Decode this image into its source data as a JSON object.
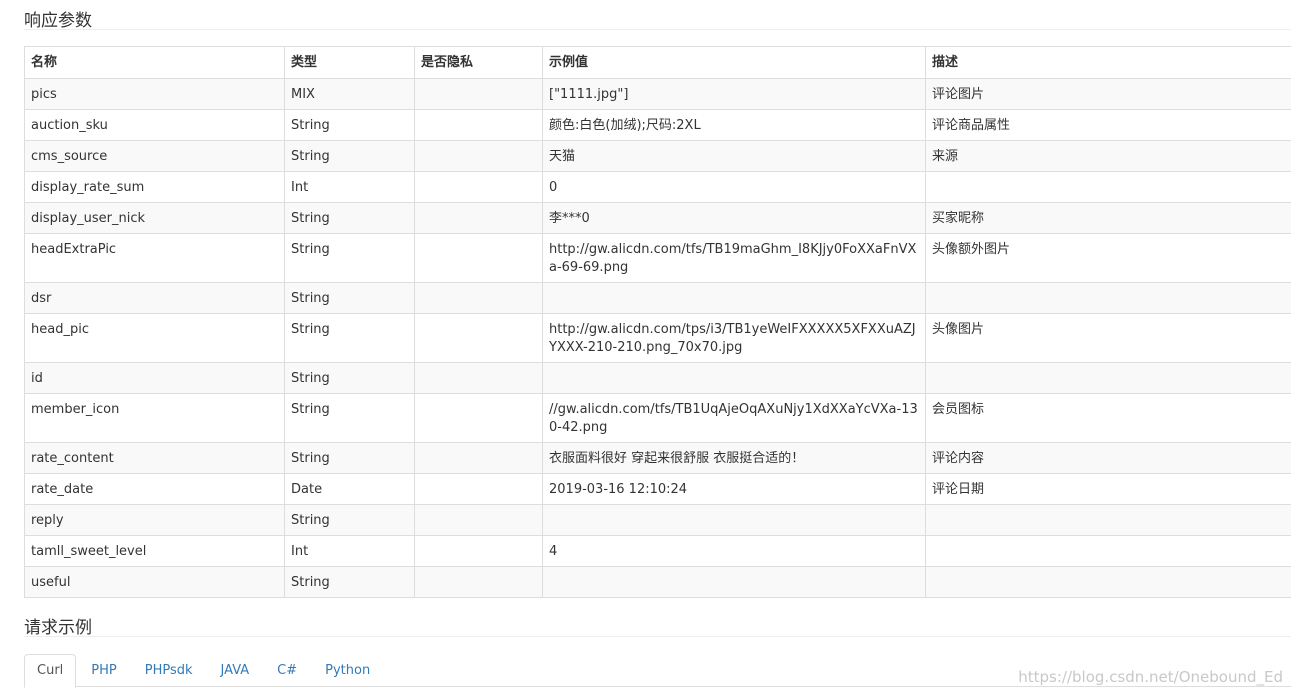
{
  "response_section": {
    "title": "响应参数"
  },
  "table": {
    "headers": [
      "名称",
      "类型",
      "是否隐私",
      "示例值",
      "描述"
    ],
    "rows": [
      {
        "name": "pics",
        "type": "MIX",
        "private": "",
        "example": "[\"1111.jpg\"]",
        "desc": "评论图片"
      },
      {
        "name": "auction_sku",
        "type": "String",
        "private": "",
        "example": "颜色:白色(加绒);尺码:2XL",
        "desc": "评论商品属性"
      },
      {
        "name": "cms_source",
        "type": "String",
        "private": "",
        "example": "天猫",
        "desc": "来源"
      },
      {
        "name": "display_rate_sum",
        "type": "Int",
        "private": "",
        "example": "0",
        "desc": ""
      },
      {
        "name": "display_user_nick",
        "type": "String",
        "private": "",
        "example": "李***0",
        "desc": "买家昵称"
      },
      {
        "name": "headExtraPic",
        "type": "String",
        "private": "",
        "example": "http://gw.alicdn.com/tfs/TB19maGhm_I8KJjy0FoXXaFnVXa-69-69.png",
        "desc": "头像额外图片"
      },
      {
        "name": "dsr",
        "type": "String",
        "private": "",
        "example": "",
        "desc": ""
      },
      {
        "name": "head_pic",
        "type": "String",
        "private": "",
        "example": "http://gw.alicdn.com/tps/i3/TB1yeWeIFXXXXX5XFXXuAZJYXXX-210-210.png_70x70.jpg",
        "desc": "头像图片"
      },
      {
        "name": "id",
        "type": "String",
        "private": "",
        "example": "",
        "desc": ""
      },
      {
        "name": "member_icon",
        "type": "String",
        "private": "",
        "example": "//gw.alicdn.com/tfs/TB1UqAjeOqAXuNjy1XdXXaYcVXa-130-42.png",
        "desc": "会员图标"
      },
      {
        "name": "rate_content",
        "type": "String",
        "private": "",
        "example": "衣服面料很好 穿起来很舒服 衣服挺合适的！",
        "desc": "评论内容"
      },
      {
        "name": "rate_date",
        "type": "Date",
        "private": "",
        "example": "2019-03-16 12:10:24",
        "desc": "评论日期"
      },
      {
        "name": "reply",
        "type": "String",
        "private": "",
        "example": "",
        "desc": ""
      },
      {
        "name": "tamll_sweet_level",
        "type": "Int",
        "private": "",
        "example": "4",
        "desc": ""
      },
      {
        "name": "useful",
        "type": "String",
        "private": "",
        "example": "",
        "desc": ""
      }
    ]
  },
  "request_section": {
    "title": "请求示例"
  },
  "tabs": [
    {
      "label": "Curl",
      "active": true
    },
    {
      "label": "PHP",
      "active": false
    },
    {
      "label": "PHPsdk",
      "active": false
    },
    {
      "label": "JAVA",
      "active": false
    },
    {
      "label": "C#",
      "active": false
    },
    {
      "label": "Python",
      "active": false
    }
  ],
  "watermark": "https://blog.csdn.net/Onebound_Ed"
}
